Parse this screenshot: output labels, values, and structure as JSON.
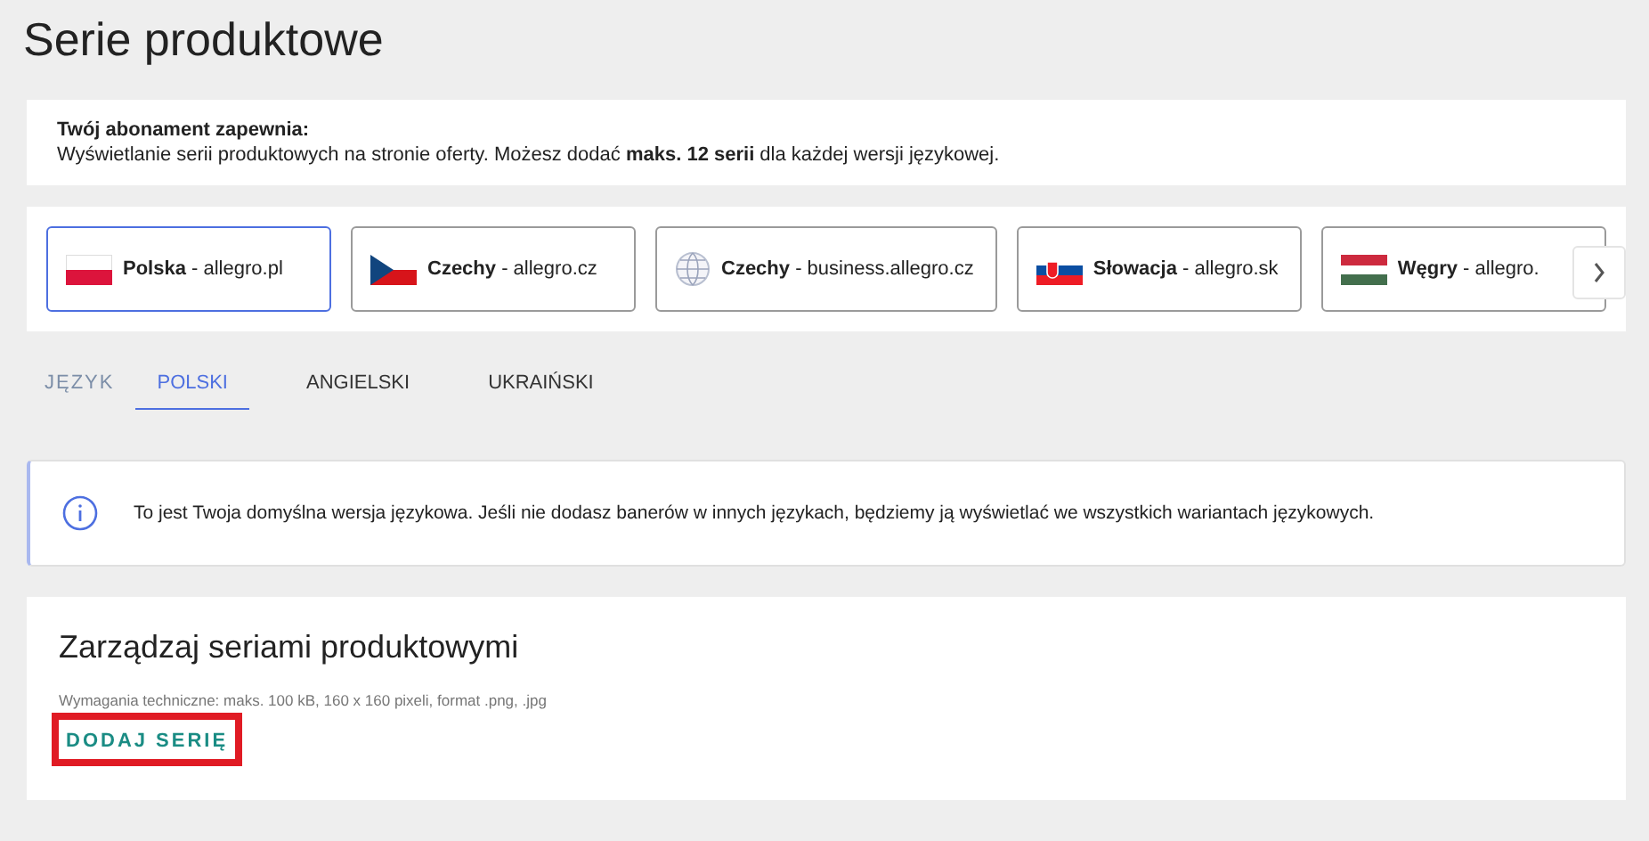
{
  "page_title": "Serie produktowe",
  "subscription": {
    "heading": "Twój abonament zapewnia:",
    "text": "Wyświetlanie serii produktowych na stronie oferty. Możesz dodać **maks. 12 serii** dla każdej wersji językowej."
  },
  "markets": [
    {
      "kind": "pl",
      "label": "**Polska** - allegro.pl",
      "selected": true
    },
    {
      "kind": "cz",
      "label": "**Czechy** - allegro.cz",
      "selected": false
    },
    {
      "kind": "globe",
      "label": "**Czechy** - business.allegro.cz",
      "selected": false
    },
    {
      "kind": "sk",
      "label": "**Słowacja** - allegro.sk",
      "selected": false
    },
    {
      "kind": "hu",
      "label": "**Węgry** - allegro.",
      "selected": false
    }
  ],
  "language_label": "JĘZYK",
  "languages": [
    {
      "label": "POLSKI",
      "selected": true
    },
    {
      "label": "ANGIELSKI",
      "selected": false
    },
    {
      "label": "UKRAIŃSKI",
      "selected": false
    }
  ],
  "notice": "To jest Twoja domyślna wersja językowa. Jeśli nie dodasz banerów w innych językach, będziemy ją wyświetlać we wszystkich wariantach językowych.",
  "manage": {
    "title": "Zarządzaj seriami produktowymi",
    "requirements": "Wymagania techniczne: maks. 100 kB, 160 x 160 pixeli, format .png, .jpg",
    "button": "DODAJ SERIĘ",
    "highlighted": true
  }
}
